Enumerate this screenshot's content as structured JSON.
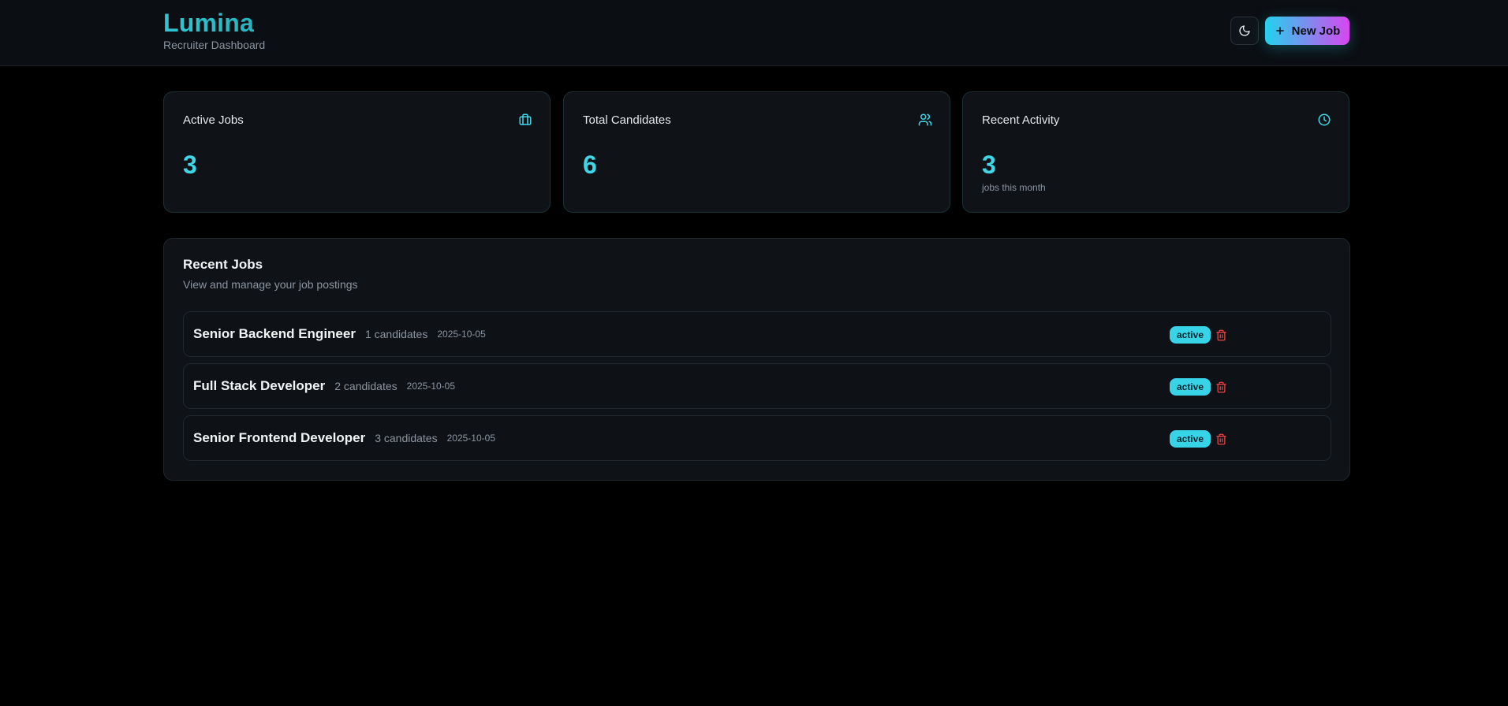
{
  "header": {
    "title": "Lumina",
    "subtitle": "Recruiter Dashboard",
    "theme_toggle_icon": "moon-icon",
    "new_job_label": "New Job",
    "new_job_icon": "plus-icon"
  },
  "stats": [
    {
      "label": "Active Jobs",
      "value": "3",
      "icon": "briefcase-icon"
    },
    {
      "label": "Total Candidates",
      "value": "6",
      "icon": "users-icon"
    },
    {
      "label": "Recent Activity",
      "value": "3",
      "note": "jobs this month",
      "icon": "clock-icon"
    }
  ],
  "recent_jobs": {
    "title": "Recent Jobs",
    "subtitle": "View and manage your job postings",
    "rows": [
      {
        "title": "Senior Backend Engineer",
        "candidates": "1 candidates",
        "date": "2025-10-05",
        "status": "active"
      },
      {
        "title": "Full Stack Developer",
        "candidates": "2 candidates",
        "date": "2025-10-05",
        "status": "active"
      },
      {
        "title": "Senior Frontend Developer",
        "candidates": "3 candidates",
        "date": "2025-10-05",
        "status": "active"
      }
    ]
  },
  "colors": {
    "accent": "#3fd7e8",
    "gradient_start": "#22d3ee",
    "gradient_end": "#d946ef",
    "danger": "#ef4444",
    "background": "#000000"
  }
}
